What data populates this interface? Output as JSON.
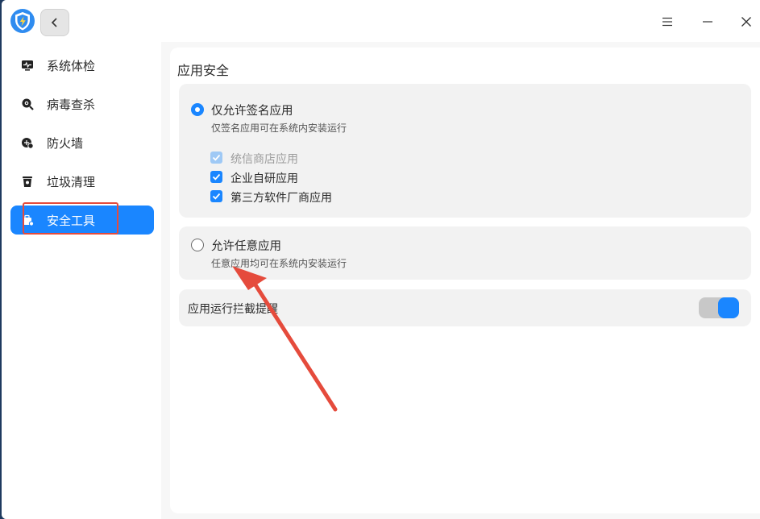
{
  "window": {
    "logo_icon": "shield-lightning-icon",
    "back_icon": "chevron-left-icon",
    "menu_icon": "hamburger-menu-icon",
    "minimize_icon": "minimize-icon",
    "close_icon": "close-icon"
  },
  "sidebar": {
    "items": [
      {
        "label": "系统体检",
        "icon": "monitor-pulse-icon",
        "active": false
      },
      {
        "label": "病毒查杀",
        "icon": "magnifier-virus-icon",
        "active": false
      },
      {
        "label": "防火墙",
        "icon": "firewall-icon",
        "active": false
      },
      {
        "label": "垃圾清理",
        "icon": "trash-can-icon",
        "active": false
      },
      {
        "label": "安全工具",
        "icon": "toolbox-icon",
        "active": true
      }
    ]
  },
  "main": {
    "section_title": "应用安全",
    "option_signed": {
      "title": "仅允许签名应用",
      "desc": "仅签名应用可在系统内安装运行",
      "selected": true,
      "checkboxes": [
        {
          "label": "统信商店应用",
          "checked": true,
          "disabled": true
        },
        {
          "label": "企业自研应用",
          "checked": true,
          "disabled": false
        },
        {
          "label": "第三方软件厂商应用",
          "checked": true,
          "disabled": false
        }
      ]
    },
    "option_any": {
      "title": "允许任意应用",
      "desc": "任意应用均可在系统内安装运行",
      "selected": false
    },
    "block_prompt": {
      "label": "应用运行拦截提醒",
      "enabled": true
    }
  },
  "colors": {
    "accent": "#1a86ff",
    "annotation": "#e54b3c"
  }
}
